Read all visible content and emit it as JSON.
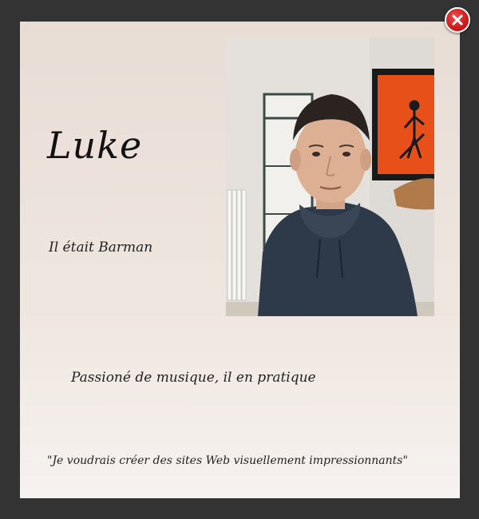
{
  "profile": {
    "name": "Luke",
    "job": "Il était Barman",
    "hobby": "Passioné de musique, il en pratique",
    "quote": "\"Je voudrais créer des sites Web visuellement impressionnants\""
  },
  "photo": {
    "subject": "portrait of a man in a dark hoodie",
    "background_art_color": "#e8501a"
  },
  "colors": {
    "overlay": "#333333",
    "close_button": "#c41414",
    "text": "#222222"
  }
}
